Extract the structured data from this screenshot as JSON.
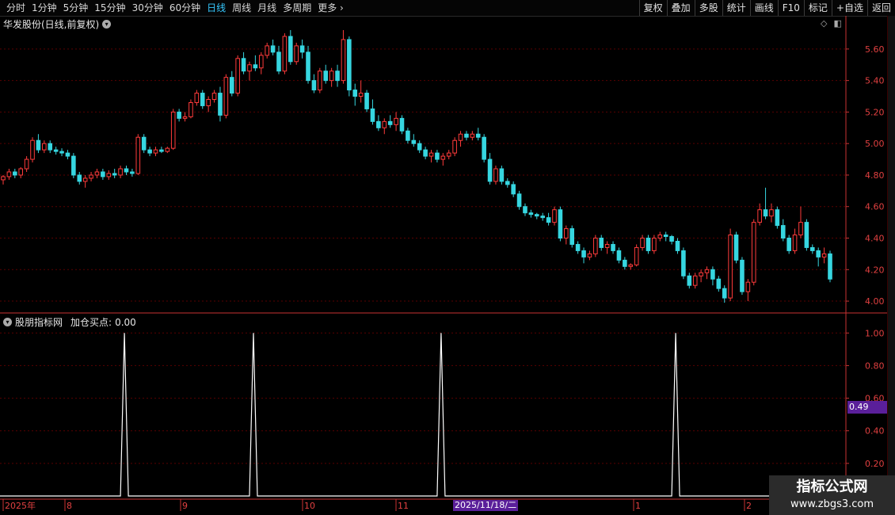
{
  "toolbar": {
    "tabs": [
      {
        "label": "分时",
        "active": false
      },
      {
        "label": "1分钟",
        "active": false
      },
      {
        "label": "5分钟",
        "active": false
      },
      {
        "label": "15分钟",
        "active": false
      },
      {
        "label": "30分钟",
        "active": false
      },
      {
        "label": "60分钟",
        "active": false
      },
      {
        "label": "日线",
        "active": true
      },
      {
        "label": "周线",
        "active": false
      },
      {
        "label": "月线",
        "active": false
      },
      {
        "label": "多周期",
        "active": false
      },
      {
        "label": "更多",
        "active": false
      }
    ],
    "right_buttons": [
      "复权",
      "叠加",
      "多股",
      "统计",
      "画线",
      "F10",
      "标记",
      "+自选",
      "返回"
    ]
  },
  "main_chart": {
    "title": "华发股份(日线,前复权)",
    "y_ticks": [
      "5.60",
      "5.40",
      "5.20",
      "5.00",
      "4.80",
      "4.60",
      "4.40",
      "4.20",
      "4.00"
    ],
    "colors": {
      "up": "#ff3b3b",
      "down": "#36d6e0",
      "grid": "#5a0000",
      "axis": "#c83232"
    }
  },
  "indicator": {
    "name": "股朋指标网",
    "label": "加仓买点:",
    "value": "0.00",
    "y_ticks": [
      "1.00",
      "0.80",
      "0.60",
      "0.40",
      "0.20"
    ],
    "cursor_value": "0.49"
  },
  "x_axis": {
    "labels": [
      "2025年",
      "8",
      "9",
      "10",
      "11",
      "1",
      "2"
    ],
    "highlight": "2025/11/18/二"
  },
  "watermark": {
    "line1": "指标公式网",
    "line2": "www.zbgs3.com"
  },
  "chart_data": {
    "type": "candlestick",
    "title": "华发股份(日线,前复权)",
    "ylim": [
      3.95,
      5.72
    ],
    "candles": [
      [
        4.77,
        4.8,
        4.74,
        4.79
      ],
      [
        4.79,
        4.84,
        4.77,
        4.82
      ],
      [
        4.82,
        4.84,
        4.78,
        4.8
      ],
      [
        4.8,
        4.85,
        4.78,
        4.84
      ],
      [
        4.84,
        4.92,
        4.82,
        4.9
      ],
      [
        4.9,
        5.04,
        4.88,
        5.02
      ],
      [
        5.02,
        5.06,
        4.94,
        4.96
      ],
      [
        4.96,
        5.02,
        4.94,
        5.0
      ],
      [
        5.0,
        5.02,
        4.94,
        4.96
      ],
      [
        4.96,
        4.98,
        4.93,
        4.95
      ],
      [
        4.95,
        4.97,
        4.92,
        4.94
      ],
      [
        4.94,
        4.96,
        4.9,
        4.92
      ],
      [
        4.92,
        4.94,
        4.78,
        4.8
      ],
      [
        4.8,
        4.82,
        4.74,
        4.76
      ],
      [
        4.76,
        4.8,
        4.72,
        4.78
      ],
      [
        4.78,
        4.82,
        4.76,
        4.8
      ],
      [
        4.8,
        4.84,
        4.78,
        4.82
      ],
      [
        4.82,
        4.84,
        4.77,
        4.79
      ],
      [
        4.79,
        4.83,
        4.77,
        4.81
      ],
      [
        4.81,
        4.84,
        4.78,
        4.8
      ],
      [
        4.8,
        4.86,
        4.78,
        4.84
      ],
      [
        4.84,
        4.86,
        4.8,
        4.82
      ],
      [
        4.82,
        4.84,
        4.79,
        4.81
      ],
      [
        4.81,
        5.06,
        4.8,
        5.04
      ],
      [
        5.04,
        5.06,
        4.94,
        4.96
      ],
      [
        4.96,
        4.98,
        4.92,
        4.94
      ],
      [
        4.94,
        4.98,
        4.92,
        4.96
      ],
      [
        4.96,
        4.98,
        4.94,
        4.95
      ],
      [
        4.95,
        4.98,
        4.94,
        4.97
      ],
      [
        4.97,
        5.22,
        4.96,
        5.2
      ],
      [
        5.2,
        5.22,
        5.14,
        5.16
      ],
      [
        5.16,
        5.2,
        5.14,
        5.17
      ],
      [
        5.17,
        5.28,
        5.16,
        5.26
      ],
      [
        5.26,
        5.34,
        5.24,
        5.32
      ],
      [
        5.32,
        5.34,
        5.22,
        5.24
      ],
      [
        5.24,
        5.3,
        5.2,
        5.28
      ],
      [
        5.28,
        5.34,
        5.26,
        5.32
      ],
      [
        5.32,
        5.36,
        5.14,
        5.18
      ],
      [
        5.18,
        5.44,
        5.16,
        5.42
      ],
      [
        5.42,
        5.46,
        5.3,
        5.32
      ],
      [
        5.32,
        5.56,
        5.3,
        5.54
      ],
      [
        5.54,
        5.58,
        5.44,
        5.46
      ],
      [
        5.46,
        5.52,
        5.4,
        5.5
      ],
      [
        5.5,
        5.56,
        5.46,
        5.48
      ],
      [
        5.48,
        5.58,
        5.44,
        5.56
      ],
      [
        5.56,
        5.64,
        5.54,
        5.62
      ],
      [
        5.62,
        5.66,
        5.56,
        5.58
      ],
      [
        5.58,
        5.62,
        5.44,
        5.46
      ],
      [
        5.46,
        5.7,
        5.44,
        5.68
      ],
      [
        5.68,
        5.72,
        5.5,
        5.52
      ],
      [
        5.52,
        5.64,
        5.5,
        5.62
      ],
      [
        5.62,
        5.66,
        5.54,
        5.58
      ],
      [
        5.58,
        5.62,
        5.38,
        5.4
      ],
      [
        5.4,
        5.44,
        5.32,
        5.34
      ],
      [
        5.34,
        5.48,
        5.32,
        5.46
      ],
      [
        5.46,
        5.5,
        5.38,
        5.4
      ],
      [
        5.4,
        5.48,
        5.36,
        5.46
      ],
      [
        5.46,
        5.5,
        5.36,
        5.4
      ],
      [
        5.4,
        5.72,
        5.38,
        5.66
      ],
      [
        5.66,
        5.68,
        5.3,
        5.34
      ],
      [
        5.34,
        5.38,
        5.24,
        5.3
      ],
      [
        5.3,
        5.4,
        5.26,
        5.32
      ],
      [
        5.32,
        5.34,
        5.2,
        5.22
      ],
      [
        5.22,
        5.28,
        5.12,
        5.14
      ],
      [
        5.14,
        5.18,
        5.08,
        5.1
      ],
      [
        5.1,
        5.16,
        5.06,
        5.14
      ],
      [
        5.14,
        5.18,
        5.1,
        5.12
      ],
      [
        5.12,
        5.2,
        5.08,
        5.16
      ],
      [
        5.16,
        5.18,
        5.06,
        5.08
      ],
      [
        5.08,
        5.1,
        5.0,
        5.02
      ],
      [
        5.02,
        5.06,
        4.98,
        5.0
      ],
      [
        5.0,
        5.02,
        4.94,
        4.96
      ],
      [
        4.96,
        4.98,
        4.9,
        4.92
      ],
      [
        4.92,
        4.96,
        4.88,
        4.94
      ],
      [
        4.94,
        4.96,
        4.88,
        4.9
      ],
      [
        4.9,
        4.94,
        4.86,
        4.92
      ],
      [
        4.92,
        4.96,
        4.9,
        4.94
      ],
      [
        4.94,
        5.04,
        4.92,
        5.02
      ],
      [
        5.02,
        5.08,
        4.98,
        5.06
      ],
      [
        5.06,
        5.08,
        5.02,
        5.04
      ],
      [
        5.04,
        5.08,
        5.02,
        5.06
      ],
      [
        5.06,
        5.1,
        5.02,
        5.04
      ],
      [
        5.04,
        5.06,
        4.88,
        4.9
      ],
      [
        4.9,
        4.94,
        4.74,
        4.76
      ],
      [
        4.76,
        4.86,
        4.74,
        4.84
      ],
      [
        4.84,
        4.86,
        4.74,
        4.76
      ],
      [
        4.76,
        4.78,
        4.72,
        4.74
      ],
      [
        4.74,
        4.76,
        4.66,
        4.68
      ],
      [
        4.68,
        4.7,
        4.58,
        4.6
      ],
      [
        4.6,
        4.62,
        4.54,
        4.56
      ],
      [
        4.56,
        4.58,
        4.53,
        4.55
      ],
      [
        4.55,
        4.56,
        4.52,
        4.54
      ],
      [
        4.54,
        4.56,
        4.51,
        4.53
      ],
      [
        4.53,
        4.56,
        4.48,
        4.5
      ],
      [
        4.5,
        4.6,
        4.48,
        4.58
      ],
      [
        4.58,
        4.6,
        4.38,
        4.4
      ],
      [
        4.4,
        4.48,
        4.36,
        4.46
      ],
      [
        4.46,
        4.48,
        4.34,
        4.36
      ],
      [
        4.36,
        4.38,
        4.3,
        4.32
      ],
      [
        4.32,
        4.34,
        4.24,
        4.28
      ],
      [
        4.28,
        4.32,
        4.26,
        4.3
      ],
      [
        4.3,
        4.42,
        4.28,
        4.4
      ],
      [
        4.4,
        4.42,
        4.32,
        4.34
      ],
      [
        4.34,
        4.38,
        4.3,
        4.36
      ],
      [
        4.36,
        4.38,
        4.3,
        4.32
      ],
      [
        4.32,
        4.34,
        4.24,
        4.26
      ],
      [
        4.26,
        4.28,
        4.2,
        4.22
      ],
      [
        4.22,
        4.24,
        4.2,
        4.23
      ],
      [
        4.23,
        4.36,
        4.22,
        4.34
      ],
      [
        4.34,
        4.42,
        4.32,
        4.4
      ],
      [
        4.4,
        4.42,
        4.3,
        4.32
      ],
      [
        4.32,
        4.42,
        4.3,
        4.4
      ],
      [
        4.4,
        4.44,
        4.38,
        4.42
      ],
      [
        4.42,
        4.44,
        4.38,
        4.41
      ],
      [
        4.41,
        4.42,
        4.36,
        4.38
      ],
      [
        4.38,
        4.4,
        4.3,
        4.32
      ],
      [
        4.32,
        4.34,
        4.14,
        4.16
      ],
      [
        4.16,
        4.18,
        4.08,
        4.1
      ],
      [
        4.1,
        4.18,
        4.08,
        4.16
      ],
      [
        4.16,
        4.2,
        4.12,
        4.18
      ],
      [
        4.18,
        4.22,
        4.14,
        4.2
      ],
      [
        4.2,
        4.22,
        4.1,
        4.14
      ],
      [
        4.14,
        4.16,
        4.06,
        4.08
      ],
      [
        4.08,
        4.1,
        3.99,
        4.02
      ],
      [
        4.02,
        4.46,
        4.0,
        4.42
      ],
      [
        4.42,
        4.44,
        4.24,
        4.26
      ],
      [
        4.26,
        4.28,
        4.04,
        4.06
      ],
      [
        4.06,
        4.14,
        4.0,
        4.12
      ],
      [
        4.12,
        4.52,
        4.1,
        4.5
      ],
      [
        4.5,
        4.62,
        4.48,
        4.58
      ],
      [
        4.58,
        4.72,
        4.52,
        4.54
      ],
      [
        4.54,
        4.62,
        4.5,
        4.58
      ],
      [
        4.58,
        4.6,
        4.46,
        4.48
      ],
      [
        4.48,
        4.52,
        4.38,
        4.4
      ],
      [
        4.4,
        4.42,
        4.3,
        4.32
      ],
      [
        4.32,
        4.46,
        4.3,
        4.42
      ],
      [
        4.42,
        4.6,
        4.4,
        4.5
      ],
      [
        4.5,
        4.52,
        4.32,
        4.34
      ],
      [
        4.34,
        4.36,
        4.3,
        4.32
      ],
      [
        4.32,
        4.34,
        4.22,
        4.28
      ],
      [
        4.28,
        4.34,
        4.24,
        4.3
      ],
      [
        4.3,
        4.32,
        4.12,
        4.14
      ]
    ],
    "indicator_series": {
      "name": "加仓买点",
      "spikes_at_index": [
        20,
        42,
        74,
        114
      ],
      "values_at_spike": 1.0,
      "baseline": 0.0,
      "ylim": [
        0,
        1.05
      ]
    }
  }
}
